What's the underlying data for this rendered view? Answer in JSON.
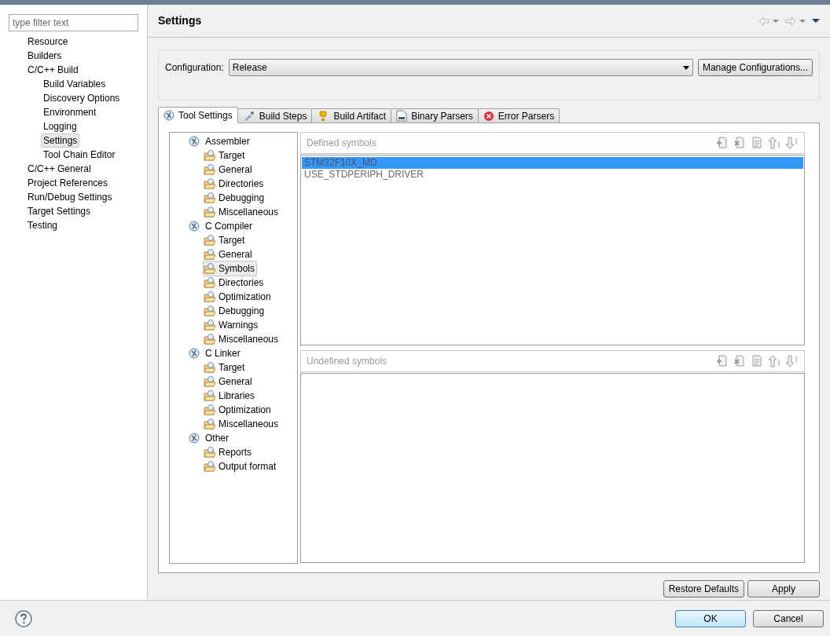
{
  "filter": {
    "placeholder": "type filter text"
  },
  "sidebar": {
    "items": [
      {
        "label": "Resource",
        "selected": false
      },
      {
        "label": "Builders",
        "selected": false
      },
      {
        "label": "C/C++ Build",
        "selected": false,
        "children": [
          {
            "label": "Build Variables",
            "selected": false
          },
          {
            "label": "Discovery Options",
            "selected": false
          },
          {
            "label": "Environment",
            "selected": false
          },
          {
            "label": "Logging",
            "selected": false
          },
          {
            "label": "Settings",
            "selected": true
          },
          {
            "label": "Tool Chain Editor",
            "selected": false
          }
        ]
      },
      {
        "label": "C/C++ General",
        "selected": false
      },
      {
        "label": "Project References",
        "selected": false
      },
      {
        "label": "Run/Debug Settings",
        "selected": false
      },
      {
        "label": "Target Settings",
        "selected": false
      },
      {
        "label": "Testing",
        "selected": false
      }
    ]
  },
  "page": {
    "title": "Settings"
  },
  "configuration": {
    "label": "Configuration:",
    "value": "Release",
    "manage_button": "Manage Configurations..."
  },
  "tabs": [
    {
      "label": "Tool Settings",
      "kind": "tool",
      "selected": true
    },
    {
      "label": "Build Steps",
      "kind": "steps",
      "selected": false
    },
    {
      "label": "Build Artifact",
      "kind": "artifact",
      "selected": false
    },
    {
      "label": "Binary Parsers",
      "kind": "binary",
      "selected": false
    },
    {
      "label": "Error Parsers",
      "kind": "error",
      "selected": false
    }
  ],
  "tool_tree": [
    {
      "label": "Assembler",
      "selected": false,
      "children": [
        {
          "label": "Target",
          "selected": false
        },
        {
          "label": "General",
          "selected": false
        },
        {
          "label": "Directories",
          "selected": false
        },
        {
          "label": "Debugging",
          "selected": false
        },
        {
          "label": "Miscellaneous",
          "selected": false
        }
      ]
    },
    {
      "label": "C Compiler",
      "selected": false,
      "children": [
        {
          "label": "Target",
          "selected": false
        },
        {
          "label": "General",
          "selected": false
        },
        {
          "label": "Symbols",
          "selected": true
        },
        {
          "label": "Directories",
          "selected": false
        },
        {
          "label": "Optimization",
          "selected": false
        },
        {
          "label": "Debugging",
          "selected": false
        },
        {
          "label": "Warnings",
          "selected": false
        },
        {
          "label": "Miscellaneous",
          "selected": false
        }
      ]
    },
    {
      "label": "C Linker",
      "selected": false,
      "children": [
        {
          "label": "Target",
          "selected": false
        },
        {
          "label": "General",
          "selected": false
        },
        {
          "label": "Libraries",
          "selected": false
        },
        {
          "label": "Optimization",
          "selected": false
        },
        {
          "label": "Miscellaneous",
          "selected": false
        }
      ]
    },
    {
      "label": "Other",
      "selected": false,
      "children": [
        {
          "label": "Reports",
          "selected": false
        },
        {
          "label": "Output format",
          "selected": false
        }
      ]
    }
  ],
  "defined_symbols": {
    "title": "Defined symbols",
    "items": [
      {
        "label": "STM32F10X_MD",
        "selected": true
      },
      {
        "label": "USE_STDPERIPH_DRIVER",
        "selected": false
      }
    ]
  },
  "undefined_symbols": {
    "title": "Undefined symbols"
  },
  "page_buttons": [
    "Restore Defaults",
    "Apply"
  ],
  "dialog_buttons": [
    {
      "label": "OK",
      "kind": "default"
    },
    {
      "label": "Cancel",
      "kind": "normal"
    }
  ]
}
